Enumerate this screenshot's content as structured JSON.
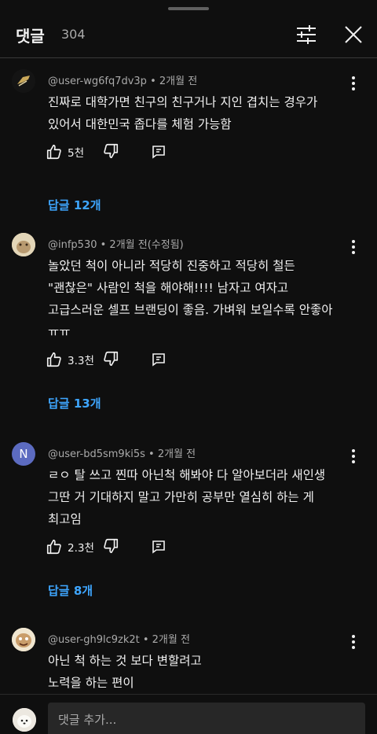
{
  "header": {
    "title": "댓글",
    "count": "304"
  },
  "comments": [
    {
      "meta": "@user-wg6fq7dv3p • 2개월 전",
      "lines": [
        "진짜로 대학가면 친구의 친구거나 지인 겹치는 경우가",
        "있어서 대한민국 좁다를 체험 가능함"
      ],
      "likes": "5천",
      "replies": "답글 12개"
    },
    {
      "meta": "@infp530 • 2개월 전(수정됨)",
      "lines": [
        "놀았던 척이 아니라 적당히 진중하고 적당히 철든",
        "\"괜찮은\" 사람인 척을 해야해!!!! 남자고 여자고",
        "고급스러운 셀프 브랜딩이 좋음. 가벼워 보일수록 안좋아",
        "ㅠㅠ"
      ],
      "likes": "3.3천",
      "replies": "답글 13개"
    },
    {
      "meta": "@user-bd5sm9ki5s • 2개월 전",
      "avatar_letter": "N",
      "avatar_color": "#5c6bc0",
      "lines": [
        "ㄹㅇ 탈 쓰고 찐따 아닌척 해봐야 다 알아보더라 새인생",
        "그딴 거 기대하지 말고 가만히 공부만 열심히 하는 게",
        "최고임"
      ],
      "likes": "2.3천",
      "replies": "답글 8개"
    },
    {
      "meta": "@user-gh9lc9zk2t • 2개월 전",
      "lines": [
        "아닌 척 하는 것 보다 변할려고",
        "노력을 하는 편이"
      ]
    }
  ],
  "footer": {
    "placeholder": "댓글 추가..."
  },
  "colors": {
    "background": "#0f0f0f",
    "link": "#3ea6ff",
    "muted": "#aaaaaa"
  },
  "icons": [
    "filter-icon",
    "close-icon",
    "more-vert-icon",
    "thumb-up-icon",
    "thumb-down-icon",
    "reply-icon"
  ]
}
